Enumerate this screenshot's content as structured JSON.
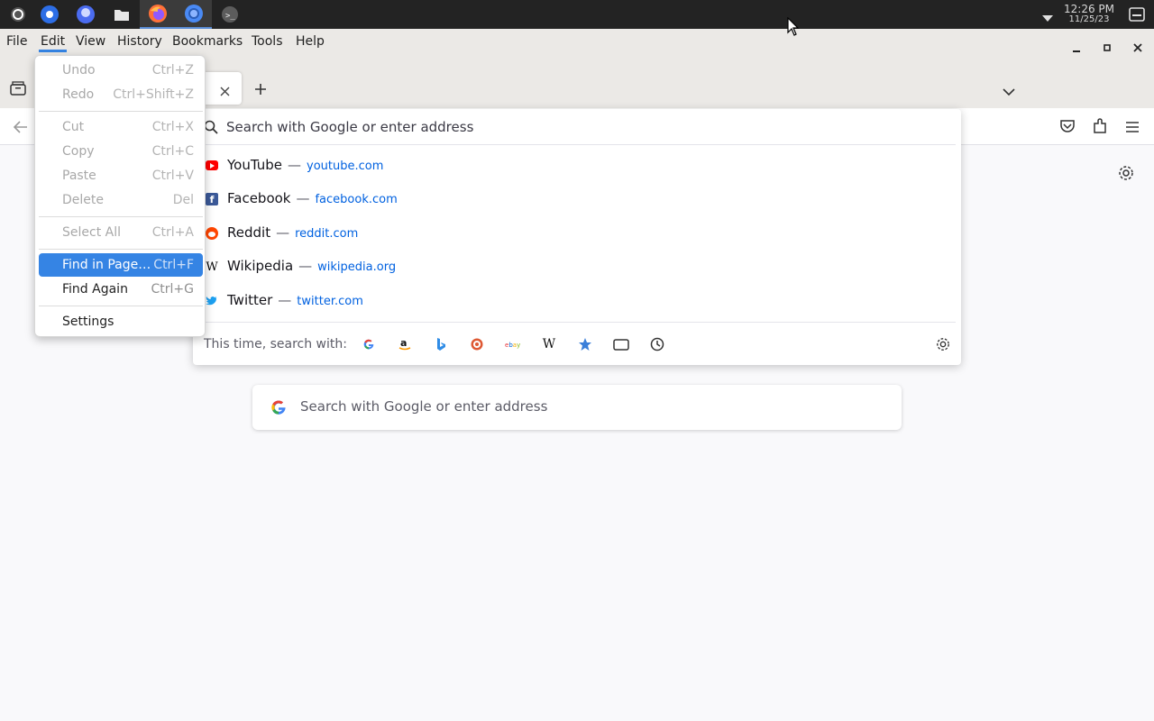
{
  "taskbar": {
    "clock_time": "12:26 PM",
    "clock_date": "11/25/23",
    "apps": [
      "activities-icon",
      "browser-app-icon",
      "chat-app-icon",
      "files-app-icon",
      "firefox-app-icon",
      "chromium-app-icon",
      "terminal-app-icon"
    ]
  },
  "menubar": {
    "items": [
      "File",
      "Edit",
      "View",
      "History",
      "Bookmarks",
      "Tools",
      "Help"
    ],
    "open_item": "Edit"
  },
  "urlbar": {
    "placeholder": "Search with Google or enter address",
    "suggestions": [
      {
        "title": "YouTube",
        "url": "youtube.com",
        "icon": "youtube-icon",
        "color": "#ff0000"
      },
      {
        "title": "Facebook",
        "url": "facebook.com",
        "icon": "facebook-icon",
        "color": "#3b5998"
      },
      {
        "title": "Reddit",
        "url": "reddit.com",
        "icon": "reddit-icon",
        "color": "#ff4500"
      },
      {
        "title": "Wikipedia",
        "url": "wikipedia.org",
        "icon": "wikipedia-icon",
        "color": "#000000"
      },
      {
        "title": "Twitter",
        "url": "twitter.com",
        "icon": "twitter-icon",
        "color": "#1da1f2"
      }
    ],
    "separator": "—",
    "oneoff_label": "This time, search with:",
    "oneoff_engines": [
      "google-icon",
      "amazon-icon",
      "bing-icon",
      "duckduckgo-icon",
      "ebay-icon",
      "wikipedia-icon",
      "bookmarks-icon",
      "tabs-icon",
      "history-icon"
    ]
  },
  "content": {
    "search_placeholder": "Search with Google or enter address"
  },
  "edit_menu": {
    "items": [
      {
        "label": "Undo",
        "accel": "Ctrl+Z",
        "disabled": true
      },
      {
        "label": "Redo",
        "accel": "Ctrl+Shift+Z",
        "disabled": true
      },
      {
        "label": "Cut",
        "accel": "Ctrl+X",
        "disabled": true
      },
      {
        "label": "Copy",
        "accel": "Ctrl+C",
        "disabled": true
      },
      {
        "label": "Paste",
        "accel": "Ctrl+V",
        "disabled": true
      },
      {
        "label": "Delete",
        "accel": "Del",
        "disabled": true
      },
      {
        "label": "Select All",
        "accel": "Ctrl+A",
        "disabled": true
      },
      {
        "label": "Find in Page…",
        "accel": "Ctrl+F",
        "disabled": false,
        "highlighted": true
      },
      {
        "label": "Find Again",
        "accel": "Ctrl+G",
        "disabled": false
      },
      {
        "label": "Settings",
        "accel": "",
        "disabled": false
      }
    ]
  },
  "colors": {
    "accent": "#3584e4",
    "link": "#0061e0"
  }
}
